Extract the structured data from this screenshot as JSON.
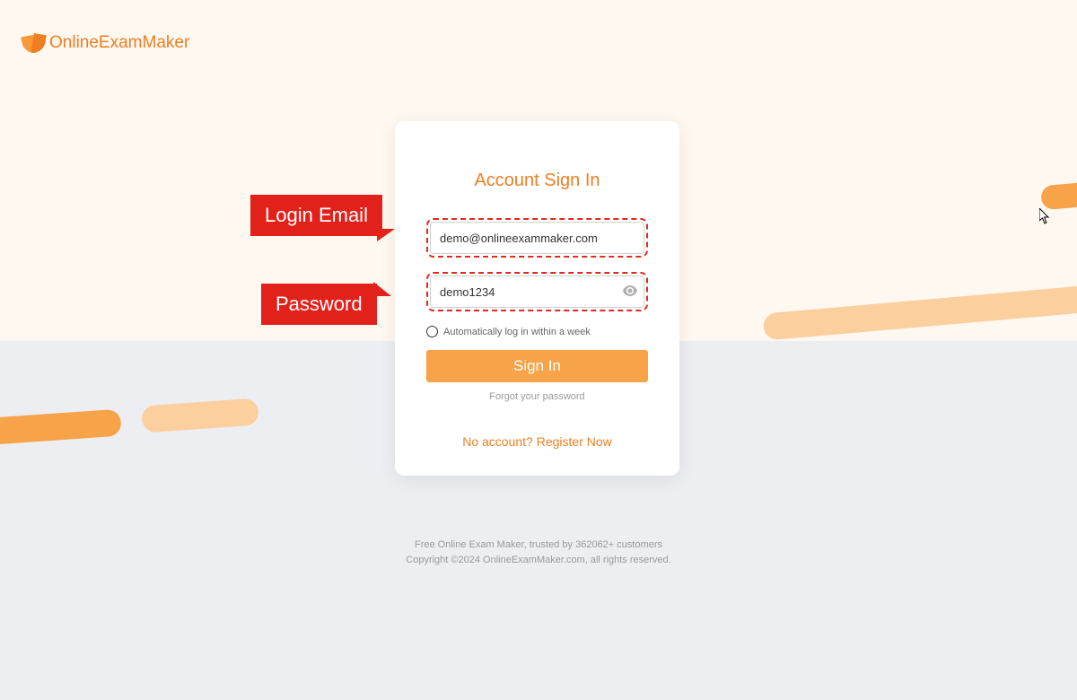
{
  "brand": {
    "name": "OnlineExamMaker"
  },
  "card": {
    "title": "Account Sign In",
    "email_value": "demo@onlineexammaker.com",
    "password_value": "demo1234",
    "auto_login_label": "Automatically log in within a week",
    "signin_label": "Sign In",
    "forgot_label": "Forgot your password",
    "register_label": "No account? Register Now"
  },
  "callouts": {
    "email": "Login Email",
    "password": "Password"
  },
  "footer": {
    "line1": "Free Online Exam Maker, trusted by 362062+ customers",
    "line2": "Copyright ©2024 OnlineExamMaker.com, all rights reserved."
  }
}
